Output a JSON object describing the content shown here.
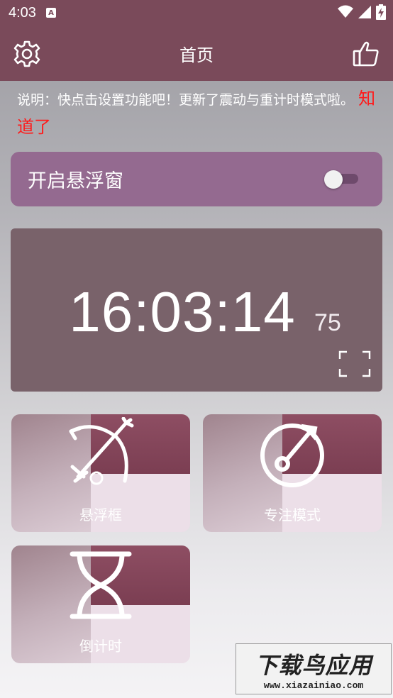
{
  "status_bar": {
    "time": "4:03",
    "notification_icon": "a-icon",
    "icons": [
      "wifi-icon",
      "signal-icon",
      "battery-icon"
    ]
  },
  "app_bar": {
    "title": "首页",
    "settings_icon": "gear-icon",
    "like_icon": "thumbs-up-icon"
  },
  "notice": {
    "text": "说明：快点击设置功能吧！更新了震动与重计时模式啦。",
    "ack_label": "知道了"
  },
  "float_window": {
    "label": "开启悬浮窗",
    "enabled": false
  },
  "clock": {
    "time": "16:03:14",
    "centiseconds": "75",
    "fullscreen_icon": "fullscreen-icon"
  },
  "tiles": [
    {
      "label": "悬浮框",
      "icon": "bow-arrow-icon"
    },
    {
      "label": "专注模式",
      "icon": "target-icon"
    },
    {
      "label": "倒计时",
      "icon": "hourglass-icon"
    }
  ],
  "colors": {
    "app_bar": "#7a4a5a",
    "toggle_card": "#946a90",
    "clock_card": "#79626a",
    "ack": "#ff1a1a"
  },
  "watermark": {
    "title": "下载鸟应用",
    "url": "www.xiazainiao.com"
  }
}
